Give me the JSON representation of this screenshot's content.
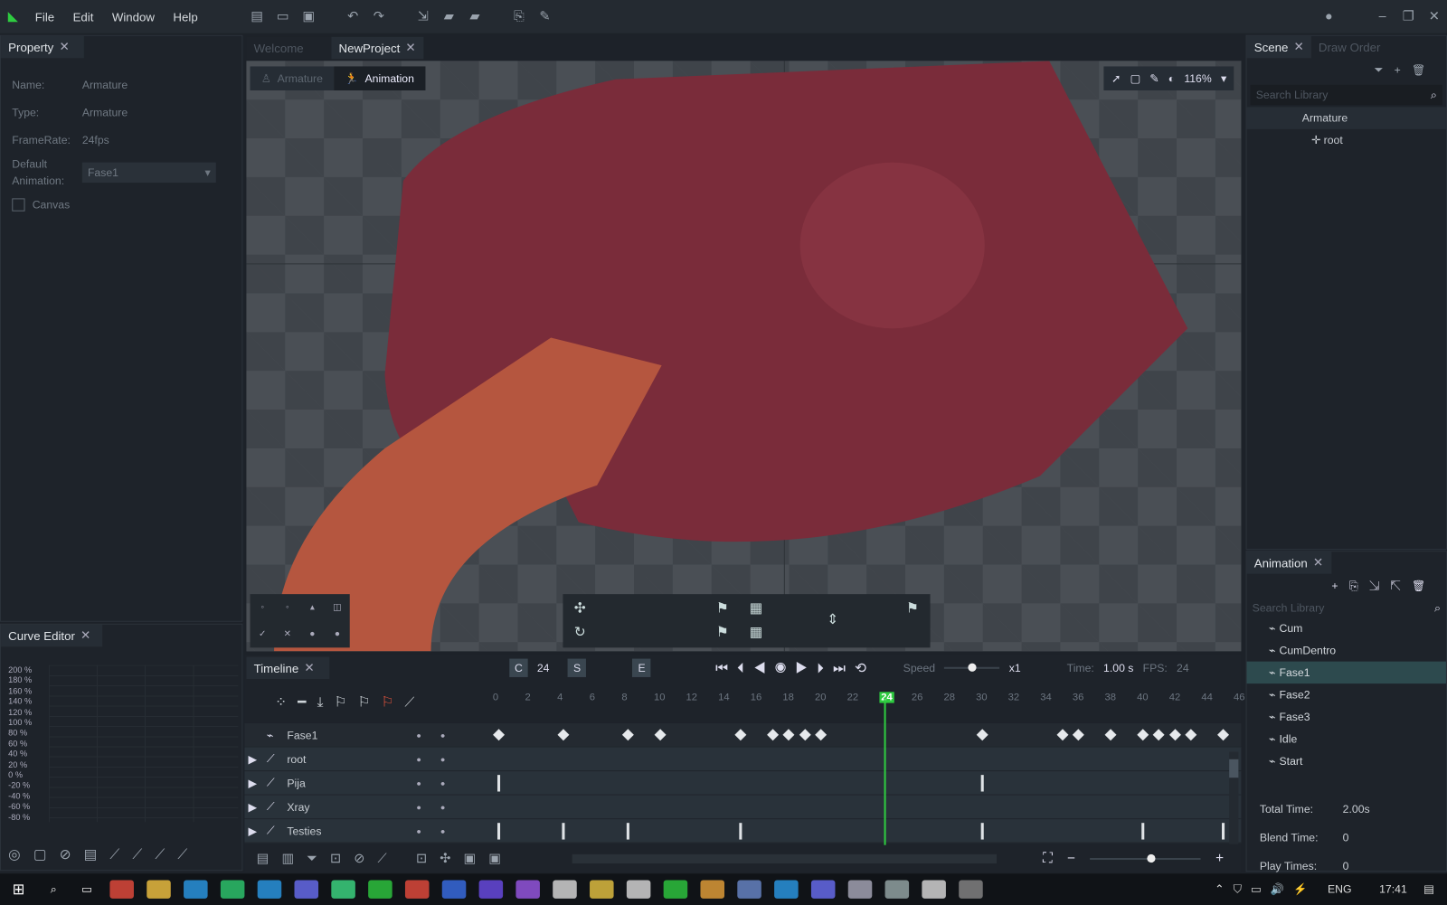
{
  "menu": [
    "File",
    "Edit",
    "Window",
    "Help"
  ],
  "left": {
    "tab": "Property",
    "props": [
      {
        "k": "Name:",
        "v": "Armature"
      },
      {
        "k": "Type:",
        "v": "Armature"
      },
      {
        "k": "FrameRate:",
        "v": "24fps"
      }
    ],
    "default_label": "Default Animation:",
    "default_value": "Fase1",
    "canvas_label": "Canvas",
    "curve_tab": "Curve Editor",
    "curve_ticks": [
      "200 %",
      "180 %",
      "160 %",
      "140 %",
      "120 %",
      "100 %",
      "80 %",
      "60 %",
      "40 %",
      "20 %",
      "0 %",
      "-20 %",
      "-40 %",
      "-60 %",
      "-80 %"
    ]
  },
  "doc_tabs": [
    "Welcome",
    "NewProject"
  ],
  "mode": {
    "armature": "Armature",
    "animation": "Animation",
    "zoom": "116%"
  },
  "timeline": {
    "tab": "Timeline",
    "c": "C",
    "c_val": "24",
    "s": "S",
    "e": "E",
    "speed_label": "Speed",
    "speed_val": "x1",
    "speed": 0.5,
    "time_label": "Time:",
    "time_val": "1.00 s",
    "fps_label": "FPS:",
    "fps_val": "24",
    "current_frame": 24,
    "frames": [
      "0",
      "2",
      "4",
      "6",
      "8",
      "10",
      "12",
      "14",
      "16",
      "18",
      "20",
      "22",
      "24",
      "26",
      "28",
      "30",
      "32",
      "34",
      "36",
      "38",
      "40",
      "42",
      "44",
      "46"
    ],
    "layers": [
      {
        "name": "Fase1",
        "keys": [
          0,
          4,
          8,
          10,
          15,
          17,
          18,
          19,
          20,
          30,
          35,
          36,
          38,
          40,
          41,
          42,
          43,
          45
        ],
        "type": "diamond"
      },
      {
        "name": "root",
        "keys": [],
        "type": "bar"
      },
      {
        "name": "Pija",
        "keys": [
          0,
          30
        ],
        "type": "bar"
      },
      {
        "name": "Xray",
        "keys": [],
        "type": "bar"
      },
      {
        "name": "Testies",
        "keys": [
          0,
          4,
          8,
          15,
          30,
          40,
          45
        ],
        "type": "bar"
      }
    ]
  },
  "right": {
    "tab_scene": "Scene",
    "tab_draw": "Draw Order",
    "search": "Search Library",
    "tree": [
      "Armature",
      "root"
    ],
    "anim_tab": "Animation",
    "anims": [
      "Cum",
      "CumDentro",
      "Fase1",
      "Fase2",
      "Fase3",
      "Idle",
      "Start"
    ],
    "selected": "Fase1",
    "total_label": "Total Time:",
    "total_val": "2.00s",
    "blend_label": "Blend Time:",
    "blend_val": "0",
    "play_label": "Play Times:",
    "play_val": "0"
  },
  "taskbar": {
    "lang": "ENG",
    "time": "17:41"
  },
  "colors": {
    "accent": "#2ecc40",
    "art": "#7a2c3a"
  }
}
